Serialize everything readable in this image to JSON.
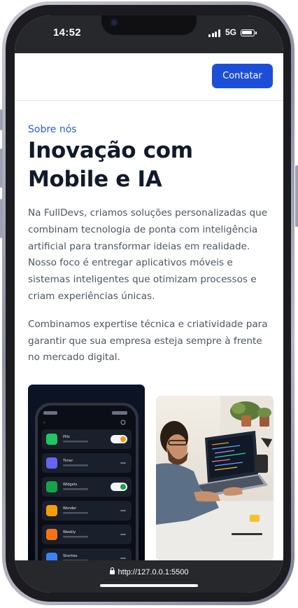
{
  "status_bar": {
    "time": "14:52",
    "network": "5G"
  },
  "header": {
    "contact_label": "Contatar"
  },
  "about": {
    "eyebrow": "Sobre nós",
    "title": "Inovação com Mobile e IA",
    "paragraph_1": "Na FullDevs, criamos soluções personalizadas que combinam tecnologia de ponta com inteligência artificial para transformar ideias em realidade. Nosso foco é entregar aplicativos móveis e sistemas inteligentes que otimizam processos e criam experiências únicas.",
    "paragraph_2": "Combinamos expertise técnica e criatividade para garantir que sua empresa esteja sempre à frente no mercado digital."
  },
  "gallery": {
    "app_items": [
      "Pills",
      "Timer",
      "Widgets",
      "Wonder",
      "Weekly",
      "Shorties"
    ]
  },
  "browser": {
    "url": "http://127.0.0.1:5500"
  }
}
